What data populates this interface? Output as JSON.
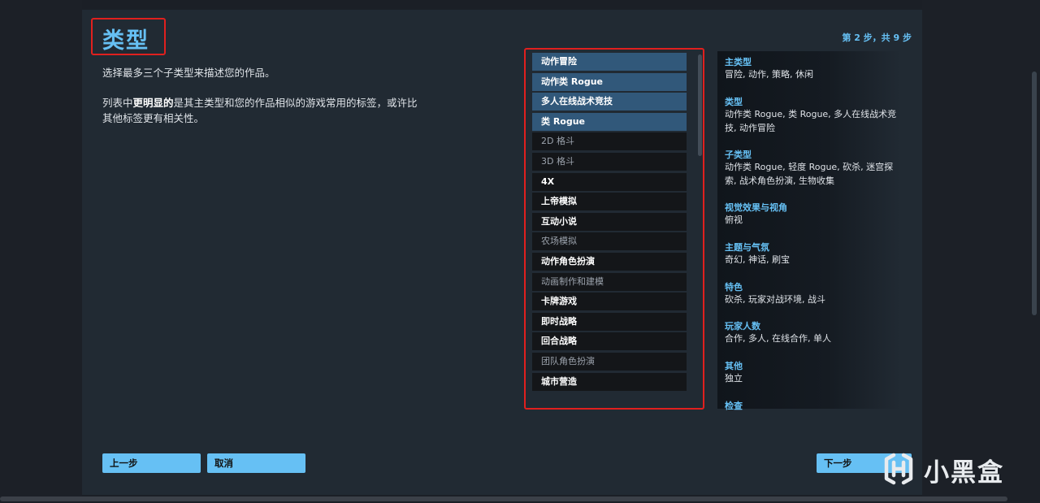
{
  "header": {
    "title": "类型",
    "step": "第 2 步，共 9 步"
  },
  "description": {
    "line1": "选择最多三个子类型来描述您的作品。",
    "line2_pre": "列表中",
    "line2_bold": "更明显的",
    "line2_post": "是其主类型和您的作品相似的游戏常用的标签，或许比",
    "line3": "其他标签更有相关性。"
  },
  "tag_list": {
    "items": [
      {
        "label": "动作冒险",
        "state": "selected"
      },
      {
        "label": "动作类 Rogue",
        "state": "selected"
      },
      {
        "label": "多人在线战术竞技",
        "state": "selected"
      },
      {
        "label": "类 Rogue",
        "state": "selected"
      },
      {
        "label": "2D 格斗",
        "state": "dim"
      },
      {
        "label": "3D 格斗",
        "state": "dim"
      },
      {
        "label": "4X",
        "state": "highlight"
      },
      {
        "label": "上帝模拟",
        "state": "highlight"
      },
      {
        "label": "互动小说",
        "state": "highlight"
      },
      {
        "label": "农场模拟",
        "state": "dim"
      },
      {
        "label": "动作角色扮演",
        "state": "highlight"
      },
      {
        "label": "动画制作和建模",
        "state": "dim"
      },
      {
        "label": "卡牌游戏",
        "state": "highlight"
      },
      {
        "label": "即时战略",
        "state": "highlight"
      },
      {
        "label": "回合战略",
        "state": "highlight"
      },
      {
        "label": "团队角色扮演",
        "state": "dim"
      },
      {
        "label": "城市营造",
        "state": "highlight"
      }
    ]
  },
  "summary": {
    "sections": [
      {
        "heading": "主类型",
        "value": "冒险, 动作, 策略, 休闲"
      },
      {
        "heading": "类型",
        "value": "动作类 Rogue, 类 Rogue, 多人在线战术竞技, 动作冒险"
      },
      {
        "heading": "子类型",
        "value": "动作类 Rogue, 轻度 Rogue, 砍杀, 迷宫探索, 战术角色扮演, 生物收集"
      },
      {
        "heading": "视觉效果与视角",
        "value": "俯视"
      },
      {
        "heading": "主题与气氛",
        "value": "奇幻, 神话, 刷宝"
      },
      {
        "heading": "特色",
        "value": "砍杀, 玩家对战环境, 战斗"
      },
      {
        "heading": "玩家人数",
        "value": "合作, 多人, 在线合作, 单人"
      },
      {
        "heading": "其他",
        "value": "独立"
      },
      {
        "heading": "检查",
        "value": ""
      }
    ]
  },
  "buttons": {
    "prev": "上一步",
    "cancel": "取消",
    "next": "下一步"
  },
  "watermark": {
    "text": "小黑盒"
  },
  "colors": {
    "accent": "#66c0f4",
    "selected_tag": "#31587a",
    "annotation_box": "#e0201e",
    "dialog_bg": "#212a33"
  }
}
